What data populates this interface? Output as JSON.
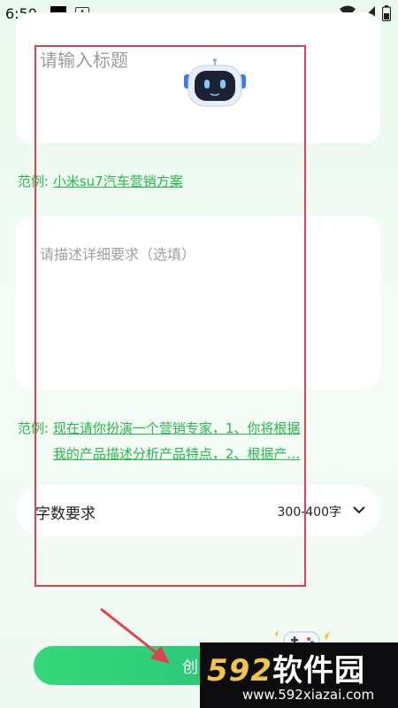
{
  "status_bar": {
    "time": "6:50"
  },
  "title_input": {
    "placeholder": "请输入标题"
  },
  "example_1": {
    "label": "范例:",
    "text": "小米su7汽车营销方案"
  },
  "desc_input": {
    "placeholder": "请描述详细要求（选填）"
  },
  "example_2": {
    "label": "范例:",
    "line1": "现在请你扮演一个营销专家，1、你将根据",
    "line2": "我的产品描述分析产品特点，2、根据产…"
  },
  "word_count": {
    "label": "字数要求",
    "value": "300-400字"
  },
  "create_button": {
    "label": "创"
  },
  "watermark": {
    "brand_num": "592",
    "brand_cn": "软件园",
    "url": "www.592xiazai.com"
  },
  "colors": {
    "accent_green": "#28b84a",
    "annotation_red": "#e0424a"
  }
}
